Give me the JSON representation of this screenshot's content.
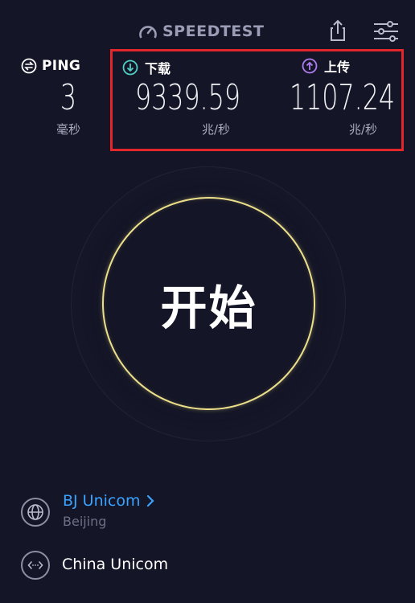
{
  "header": {
    "logo_text": "SPEEDTEST",
    "share_icon": "share-icon",
    "settings_icon": "sliders-icon"
  },
  "ping": {
    "label": "PING",
    "value": "3",
    "unit": "毫秒",
    "icon": "ping-icon"
  },
  "download": {
    "label": "下载",
    "value": "9339.59",
    "unit": "兆/秒",
    "icon": "download-arrow-icon",
    "color": "#4fd1c5"
  },
  "upload": {
    "label": "上传",
    "value": "1107.24",
    "unit": "兆/秒",
    "icon": "upload-arrow-icon",
    "color": "#b07cf0"
  },
  "start": {
    "label": "开始",
    "ring_color": "#ecdf8a"
  },
  "server": {
    "name": "BJ Unicom",
    "city": "Beijing",
    "icon": "globe-icon"
  },
  "isp": {
    "name": "China Unicom",
    "icon": "connection-icon"
  },
  "colors": {
    "background": "#141526",
    "highlight": "#e3262a",
    "link": "#3aa3ff"
  }
}
